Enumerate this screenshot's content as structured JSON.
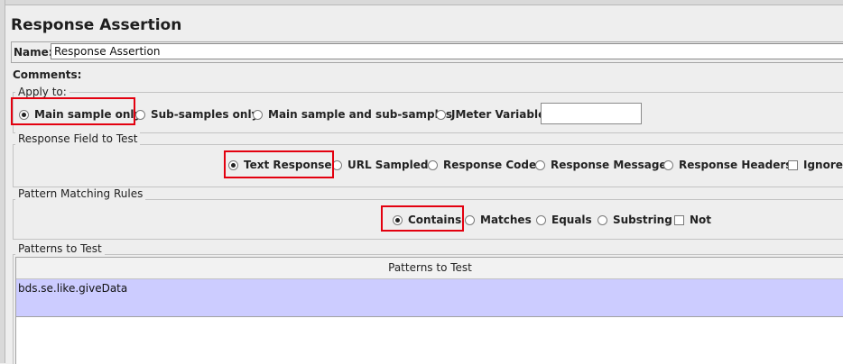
{
  "title": "Response Assertion",
  "name": {
    "label": "Name:",
    "value": "Response Assertion"
  },
  "comments": {
    "label": "Comments:"
  },
  "apply_to": {
    "title": "Apply to:",
    "options": [
      {
        "label": "Main sample only",
        "selected": true
      },
      {
        "label": "Sub-samples only",
        "selected": false
      },
      {
        "label": "Main sample and sub-samples",
        "selected": false
      },
      {
        "label": "JMeter Variable",
        "selected": false
      }
    ],
    "variable_value": ""
  },
  "response_field": {
    "title": "Response Field to Test",
    "options": [
      {
        "label": "Text Response",
        "selected": true
      },
      {
        "label": "URL Sampled",
        "selected": false
      },
      {
        "label": "Response Code",
        "selected": false
      },
      {
        "label": "Response Message",
        "selected": false
      },
      {
        "label": "Response Headers",
        "selected": false
      }
    ],
    "ignore_label": "Ignore S"
  },
  "pattern_rules": {
    "title": "Pattern Matching Rules",
    "options": [
      {
        "label": "Contains",
        "selected": true
      },
      {
        "label": "Matches",
        "selected": false
      },
      {
        "label": "Equals",
        "selected": false
      },
      {
        "label": "Substring",
        "selected": false
      }
    ],
    "not_label": "Not"
  },
  "patterns": {
    "title": "Patterns to Test",
    "column_header": "Patterns to Test",
    "rows": [
      "bds.se.like.giveData"
    ]
  },
  "colors": {
    "highlight": "#e3000f",
    "selected_row": "#ccccff"
  }
}
